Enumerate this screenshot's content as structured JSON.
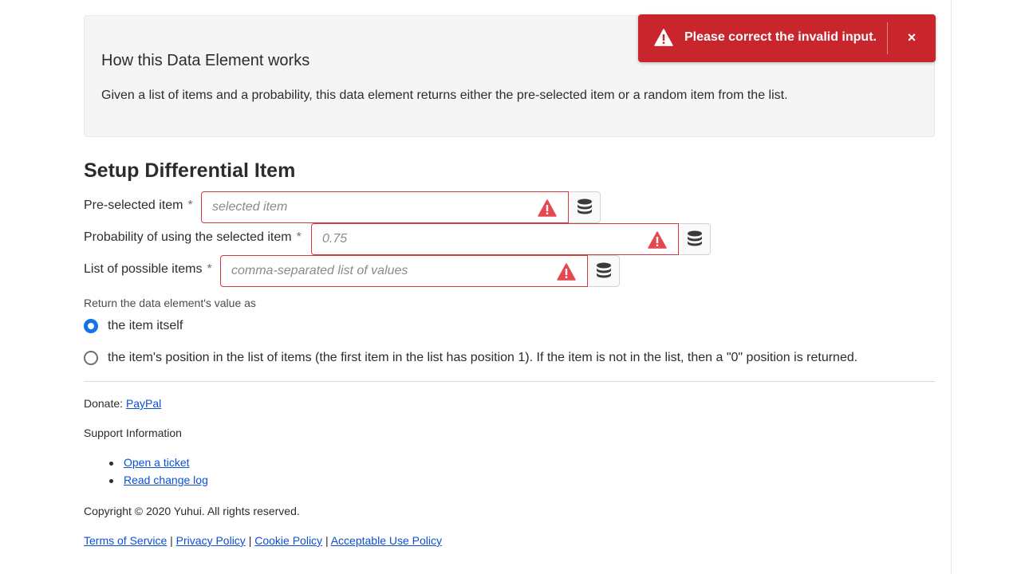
{
  "info": {
    "title": "How this Data Element works",
    "description": "Given a list of items and a probability, this data element returns either the pre-selected item or a random item from the list."
  },
  "toast": {
    "message": "Please correct the invalid input.",
    "close_symbol": "×",
    "color": "#c9252d",
    "icon": "alert-triangle-icon"
  },
  "section_title": "Setup Differential Item",
  "fields": [
    {
      "label": "Pre-selected item",
      "required_mark": "*",
      "placeholder": "selected item",
      "value": "",
      "state": "invalid"
    },
    {
      "label": "Probability of using the selected item",
      "required_mark": "*",
      "placeholder": "0.75",
      "value": "",
      "state": "invalid"
    },
    {
      "label": "List of possible items",
      "required_mark": "*",
      "placeholder": "comma-separated list of values",
      "value": "",
      "state": "invalid"
    }
  ],
  "return_as": {
    "label": "Return the data element's value as",
    "options": [
      {
        "label": "the item itself",
        "selected": true
      },
      {
        "label": "the item's position in the list of items (the first item in the list has position 1). If the item is not in the list, then a \"0\" position is returned.",
        "selected": false
      }
    ]
  },
  "footer": {
    "donate_label": "Donate:",
    "donate_link": "PayPal",
    "support_label": "Support Information",
    "support_links": [
      "Open a ticket",
      "Read change log"
    ],
    "copyright": "Copyright © 2020 Yuhui. All rights reserved.",
    "legal_links": [
      "Terms of Service",
      "Privacy Policy",
      "Cookie Policy",
      "Acceptable Use Policy"
    ],
    "separator": "|"
  },
  "colors": {
    "error": "#d7373f",
    "accent": "#1473e6",
    "link": "#0b4fd6"
  }
}
